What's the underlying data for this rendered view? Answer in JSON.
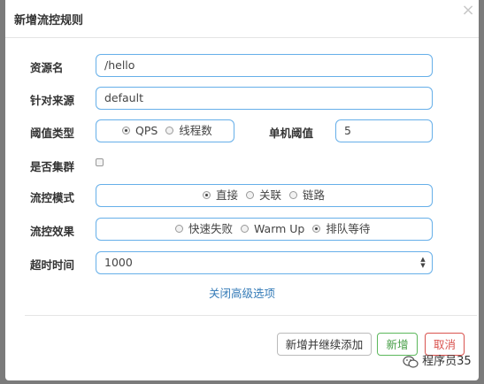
{
  "modal": {
    "title": "新增流控规则",
    "close_glyph": "×"
  },
  "form": {
    "resource": {
      "label": "资源名",
      "value": "/hello"
    },
    "limit_app": {
      "label": "针对来源",
      "value": "default"
    },
    "threshold_type": {
      "label": "阈值类型",
      "options": [
        "QPS",
        "线程数"
      ],
      "selected": "QPS"
    },
    "threshold": {
      "label": "单机阈值",
      "value": "5"
    },
    "cluster": {
      "label": "是否集群",
      "checked": false
    },
    "control_mode": {
      "label": "流控模式",
      "options": [
        "直接",
        "关联",
        "链路"
      ],
      "selected": "直接"
    },
    "control_effect": {
      "label": "流控效果",
      "options": [
        "快速失败",
        "Warm Up",
        "排队等待"
      ],
      "selected": "排队等待"
    },
    "timeout": {
      "label": "超时时间",
      "value": "1000"
    },
    "advanced_link": "关闭高级选项"
  },
  "footer": {
    "save_continue": "新增并继续添加",
    "add": "新增",
    "cancel": "取消"
  },
  "watermark": {
    "text": "程序员35",
    "icon": "wechat-icon"
  },
  "colors": {
    "input_border": "#66afe9",
    "link": "#337ab7",
    "success": "#5cb85c",
    "danger": "#d9534f"
  }
}
